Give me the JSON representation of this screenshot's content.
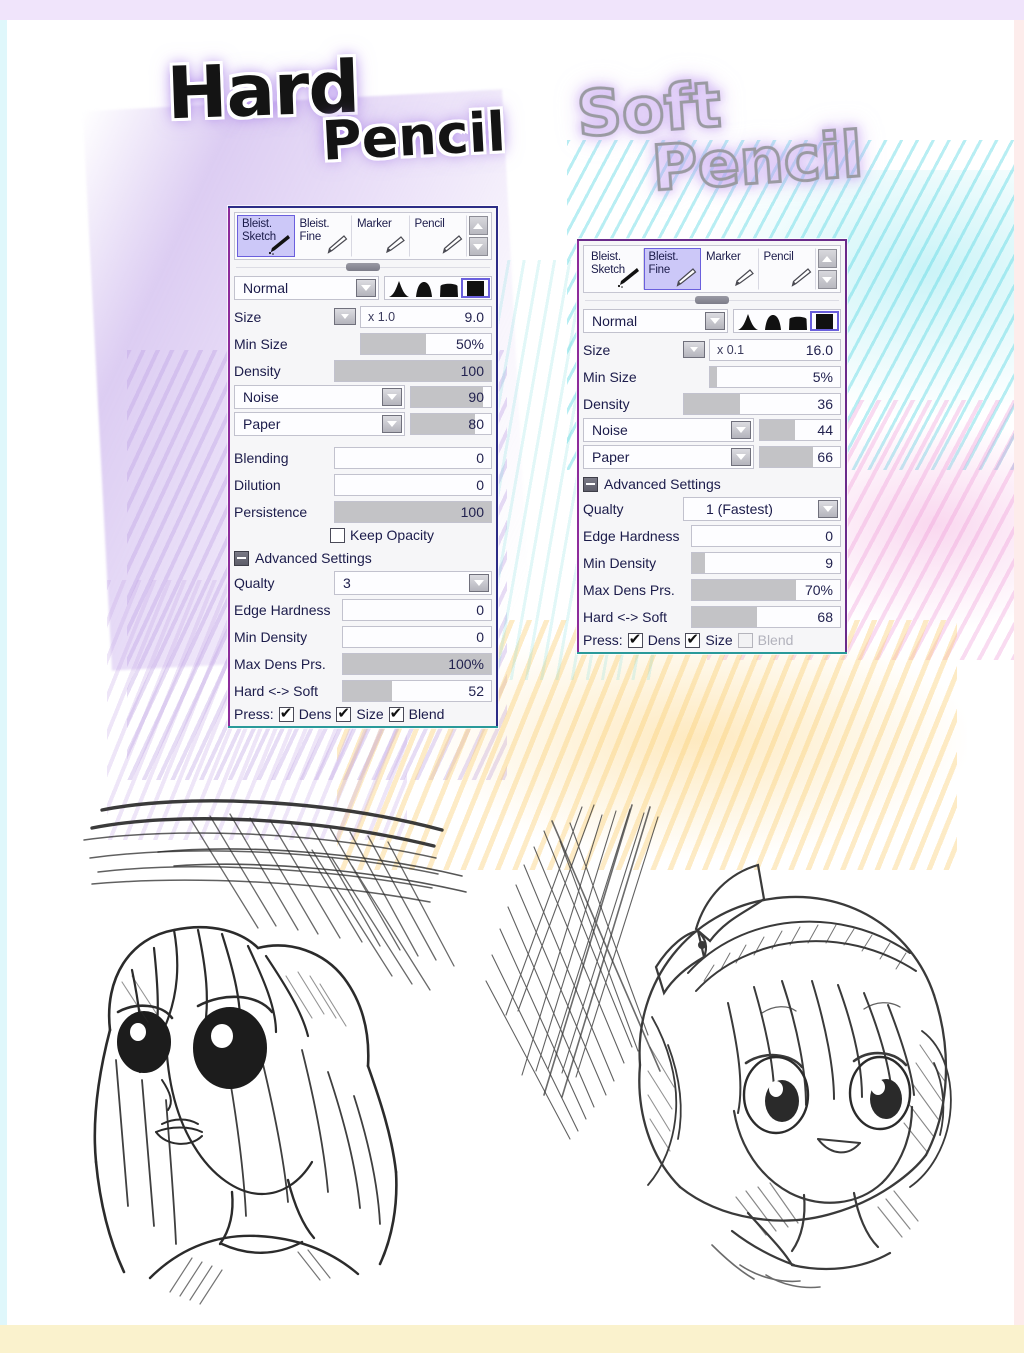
{
  "page": {
    "band_top_color": "#f0e4fb",
    "band_bottom_color": "#faf2cd",
    "band_left_color": "#dff7fb",
    "band_right_color": "#fdeceb"
  },
  "titles": {
    "hard": {
      "word1": "Hard",
      "word2": "Pencil"
    },
    "soft": {
      "word1": "Soft",
      "word2": "Pencil"
    }
  },
  "shared": {
    "tabs": [
      {
        "label": "Bleist.\nSketch",
        "icon": "pencil-dark-icon"
      },
      {
        "label": "Bleist.\nFine",
        "icon": "pencil-icon"
      },
      {
        "label": "Marker",
        "icon": "marker-icon"
      },
      {
        "label": "Pencil",
        "icon": "pencil-icon"
      }
    ],
    "spinner_up": "scroll-up-icon",
    "spinner_down": "scroll-down-icon",
    "shape_icons": [
      "tip-sharp-icon",
      "tip-round-icon",
      "tip-flat-icon",
      "tip-square-icon"
    ],
    "labels": {
      "size": "Size",
      "min_size": "Min Size",
      "density": "Density",
      "blending": "Blending",
      "dilution": "Dilution",
      "persistence": "Persistence",
      "keep_opacity": "Keep Opacity",
      "advanced_settings": "Advanced Settings",
      "quality": "Qualty",
      "edge_hardness": "Edge Hardness",
      "min_density": "Min Density",
      "max_dens_prs": "Max Dens Prs.",
      "hard_soft": "Hard <-> Soft",
      "press": "Press:",
      "dens": "Dens",
      "size_short": "Size",
      "blend": "Blend"
    }
  },
  "hard_pencil": {
    "selected_tab_index": 0,
    "blend_mode": "Normal",
    "selected_shape_index": 3,
    "size": {
      "prefix": "x 1.0",
      "value": "9.0",
      "fill_pct": 0
    },
    "min_size": {
      "value": "50%",
      "fill_pct": 50
    },
    "density": {
      "value": "100",
      "fill_pct": 100
    },
    "noise": {
      "name": "Noise",
      "value": "90",
      "fill_pct": 90
    },
    "paper": {
      "name": "Paper",
      "value": "80",
      "fill_pct": 80
    },
    "blending": {
      "value": "0",
      "fill_pct": 0
    },
    "dilution": {
      "value": "0",
      "fill_pct": 0
    },
    "persistence": {
      "value": "100",
      "fill_pct": 100
    },
    "keep_opacity_checked": false,
    "quality": "3",
    "edge_hardness": {
      "value": "0",
      "fill_pct": 0
    },
    "min_density": {
      "value": "0",
      "fill_pct": 0
    },
    "max_dens_prs": {
      "value": "100%",
      "fill_pct": 100
    },
    "hard_soft": {
      "value": "52",
      "fill_pct": 33
    },
    "press": {
      "dens": true,
      "size": true,
      "blend": true,
      "blend_enabled": true
    }
  },
  "soft_pencil": {
    "selected_tab_index": 1,
    "blend_mode": "Normal",
    "selected_shape_index": 3,
    "size": {
      "prefix": "x 0.1",
      "value": "16.0",
      "fill_pct": 0
    },
    "min_size": {
      "value": "5%",
      "fill_pct": 5
    },
    "density": {
      "value": "36",
      "fill_pct": 36
    },
    "noise": {
      "name": "Noise",
      "value": "44",
      "fill_pct": 44
    },
    "paper": {
      "name": "Paper",
      "value": "66",
      "fill_pct": 66
    },
    "quality": "1 (Fastest)",
    "edge_hardness": {
      "value": "0",
      "fill_pct": 0
    },
    "min_density": {
      "value": "9",
      "fill_pct": 9
    },
    "max_dens_prs": {
      "value": "70%",
      "fill_pct": 70
    },
    "hard_soft": {
      "value": "68",
      "fill_pct": 44
    },
    "press": {
      "dens": true,
      "size": true,
      "blend": false,
      "blend_enabled": false
    }
  },
  "sketches": {
    "left": "anime-girl-portrait-hard-pencil",
    "right": "anime-girl-chibi-soft-pencil"
  }
}
